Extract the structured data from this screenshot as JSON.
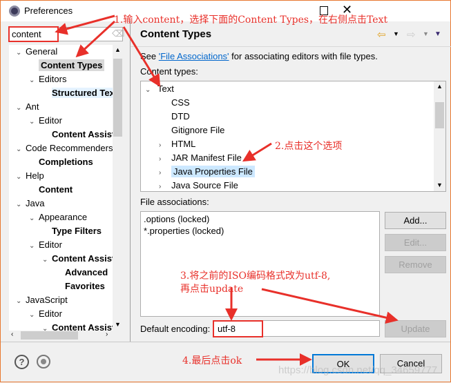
{
  "window": {
    "title": "Preferences",
    "maximize_icon": "maximize-icon",
    "close_icon": "close-icon"
  },
  "search": {
    "value": "content"
  },
  "tree": [
    {
      "label": "General",
      "level": 0,
      "expanded": true
    },
    {
      "label": "Content Types",
      "level": 1,
      "bold": true,
      "selected": true
    },
    {
      "label": "Editors",
      "level": 1,
      "expanded": true
    },
    {
      "label": "Structured Tex",
      "level": 2,
      "bold": true
    },
    {
      "label": "Ant",
      "level": 0,
      "expanded": true
    },
    {
      "label": "Editor",
      "level": 1,
      "expanded": true
    },
    {
      "label": "Content Assist",
      "level": 2,
      "bold": true
    },
    {
      "label": "Code Recommenders",
      "level": 0,
      "expanded": true
    },
    {
      "label": "Completions",
      "level": 1,
      "bold": true
    },
    {
      "label": "Help",
      "level": 0,
      "expanded": true
    },
    {
      "label": "Content",
      "level": 1,
      "bold": true
    },
    {
      "label": "Java",
      "level": 0,
      "expanded": true
    },
    {
      "label": "Appearance",
      "level": 1,
      "expanded": true
    },
    {
      "label": "Type Filters",
      "level": 2,
      "bold": true
    },
    {
      "label": "Editor",
      "level": 1,
      "expanded": true
    },
    {
      "label": "Content Assist",
      "level": 2,
      "bold": true,
      "expanded": true
    },
    {
      "label": "Advanced",
      "level": 3,
      "bold": true
    },
    {
      "label": "Favorites",
      "level": 3,
      "bold": true
    },
    {
      "label": "JavaScript",
      "level": 0,
      "expanded": true
    },
    {
      "label": "Editor",
      "level": 1,
      "expanded": true
    },
    {
      "label": "Content Assist",
      "level": 2,
      "bold": true,
      "expanded": true
    }
  ],
  "page": {
    "title": "Content Types",
    "desc_pre": "See ",
    "desc_link": "'File Associations'",
    "desc_post": " for associating editors with file types.",
    "content_types_label": "Content types:",
    "content_types": [
      {
        "label": "Text",
        "level": 0,
        "expander": "expanded"
      },
      {
        "label": "CSS",
        "level": 1,
        "expander": "none"
      },
      {
        "label": "DTD",
        "level": 1,
        "expander": "none"
      },
      {
        "label": "Gitignore File",
        "level": 1,
        "expander": "none"
      },
      {
        "label": "HTML",
        "level": 1,
        "expander": "collapsed"
      },
      {
        "label": "JAR Manifest File",
        "level": 1,
        "expander": "collapsed"
      },
      {
        "label": "Java Properties File",
        "level": 1,
        "expander": "collapsed",
        "selected": true
      },
      {
        "label": "Java Source File",
        "level": 1,
        "expander": "collapsed"
      }
    ],
    "file_assoc_label": "File associations:",
    "file_assoc": [
      ".options (locked)",
      "*.properties (locked)"
    ],
    "add": "Add...",
    "edit": "Edit...",
    "remove": "Remove",
    "encoding_label": "Default encoding:",
    "encoding_value": "utf-8",
    "update": "Update"
  },
  "footer": {
    "ok": "OK",
    "cancel": "Cancel",
    "help_icon": "help-icon",
    "import_export_icon": "import-export-icon"
  },
  "annotations": {
    "a1": "1.输入content，选择下面的Content Types，在右侧点击Text",
    "a2": "2.点击这个选项",
    "a3_line1": "3.将之前的ISO编码格式改为utf-8,",
    "a3_line2": "再点击update",
    "a4": "4.最后点击ok"
  },
  "watermark": "https://blog.csdn.net/qq_34659777",
  "colors": {
    "annotation": "#e8302a",
    "link": "#0066cc",
    "selection": "#cce8ff",
    "ok_border": "#0078d7"
  }
}
